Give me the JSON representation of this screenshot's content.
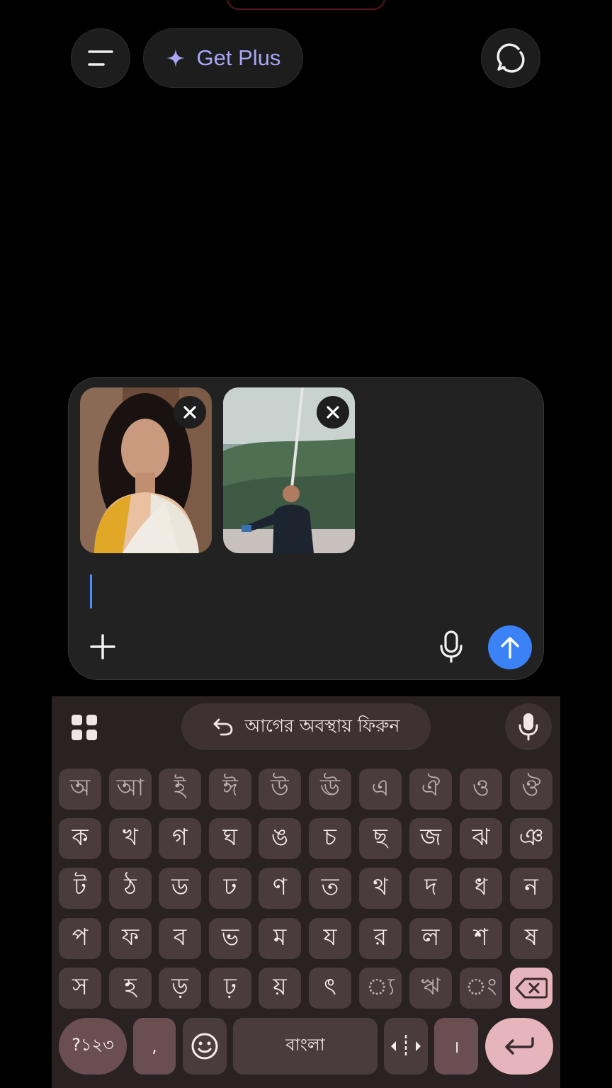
{
  "header": {
    "get_plus_label": "Get Plus"
  },
  "composer": {
    "attachments": [
      {
        "alt": "woman in saree photo"
      },
      {
        "alt": "man on balcony photo"
      }
    ],
    "input_value": ""
  },
  "keyboard": {
    "suggestion": "আগের অবস্থায় ফিরুন",
    "rows": [
      [
        "অ",
        "আ",
        "ই",
        "ঈ",
        "উ",
        "ঊ",
        "এ",
        "ঐ",
        "ও",
        "ঔ"
      ],
      [
        "ক",
        "খ",
        "গ",
        "ঘ",
        "ঙ",
        "চ",
        "ছ",
        "জ",
        "ঝ",
        "ঞ"
      ],
      [
        "ট",
        "ঠ",
        "ড",
        "ঢ",
        "ণ",
        "ত",
        "থ",
        "দ",
        "ধ",
        "ন"
      ],
      [
        "প",
        "ফ",
        "ব",
        "ভ",
        "ম",
        "য",
        "র",
        "ল",
        "শ",
        "ষ"
      ],
      [
        "স",
        "হ",
        "ড়",
        "ঢ়",
        "য়",
        "ৎ",
        "্য",
        "ঋ",
        "ং",
        ""
      ]
    ],
    "symbols_label": "?১২৩",
    "comma_label": ",",
    "space_label": "বাংলা",
    "danda_label": "।",
    "accent_color": "#3b82f6"
  }
}
